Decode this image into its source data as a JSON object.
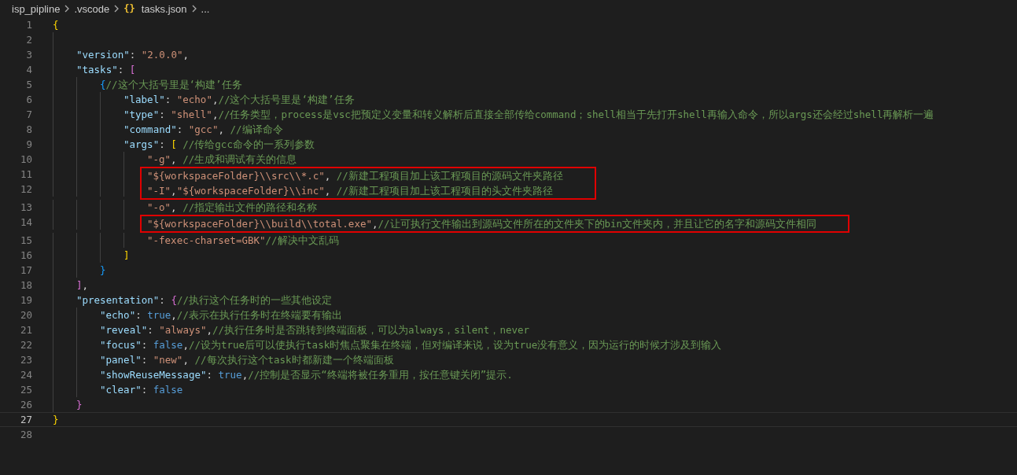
{
  "breadcrumb": [
    {
      "label": "isp_pipline",
      "kind": "folder"
    },
    {
      "label": ".vscode",
      "kind": "folder"
    },
    {
      "label": "tasks.json",
      "kind": "json",
      "icon": "{}"
    },
    {
      "label": "...",
      "kind": "more"
    }
  ],
  "lines": [
    {
      "number": "1",
      "boxed": false,
      "current": false,
      "tokens": [
        {
          "kind": "brace1",
          "text": "{"
        }
      ],
      "children": [
        {
          "number": "2",
          "boxed": false,
          "current": false
        },
        {
          "number": "3",
          "boxed": false,
          "current": false,
          "tokens": [
            {
              "kind": "key",
              "text": "\"version\""
            },
            {
              "kind": "punct",
              "text": ": "
            },
            {
              "kind": "string",
              "text": "\"2.0.0\""
            },
            {
              "kind": "punct",
              "text": ","
            }
          ]
        },
        {
          "number": "4",
          "boxed": false,
          "current": false,
          "tokens": [
            {
              "kind": "key",
              "text": "\"tasks\""
            },
            {
              "kind": "punct",
              "text": ": "
            },
            {
              "kind": "brace2",
              "text": "["
            }
          ],
          "children": [
            {
              "number": "5",
              "boxed": false,
              "current": false,
              "tokens": [
                {
                  "kind": "brace3",
                  "text": "{"
                },
                {
                  "kind": "comment",
                  "text": "//这个大括号里是‘构建’任务"
                }
              ],
              "children": [
                {
                  "number": "6",
                  "boxed": false,
                  "current": false,
                  "tokens": [
                    {
                      "kind": "key",
                      "text": "\"label\""
                    },
                    {
                      "kind": "punct",
                      "text": ": "
                    },
                    {
                      "kind": "string",
                      "text": "\"echo\""
                    },
                    {
                      "kind": "punct",
                      "text": ","
                    },
                    {
                      "kind": "comment",
                      "text": "//这个大括号里是‘构建’任务"
                    }
                  ]
                },
                {
                  "number": "7",
                  "boxed": false,
                  "current": false,
                  "tokens": [
                    {
                      "kind": "key",
                      "text": "\"type\""
                    },
                    {
                      "kind": "punct",
                      "text": ": "
                    },
                    {
                      "kind": "string",
                      "text": "\"shell\""
                    },
                    {
                      "kind": "punct",
                      "text": ","
                    },
                    {
                      "kind": "comment",
                      "text": "//任务类型，process是vsc把预定义变量和转义解析后直接全部传给command；shell相当于先打开shell再输入命令，所以args还会经过shell再解析一遍"
                    }
                  ]
                },
                {
                  "number": "8",
                  "boxed": false,
                  "current": false,
                  "tokens": [
                    {
                      "kind": "key",
                      "text": "\"command\""
                    },
                    {
                      "kind": "punct",
                      "text": ": "
                    },
                    {
                      "kind": "string",
                      "text": "\"gcc\""
                    },
                    {
                      "kind": "punct",
                      "text": ", "
                    },
                    {
                      "kind": "comment",
                      "text": "//编译命令"
                    }
                  ]
                },
                {
                  "number": "9",
                  "boxed": false,
                  "current": false,
                  "tokens": [
                    {
                      "kind": "key",
                      "text": "\"args\""
                    },
                    {
                      "kind": "punct",
                      "text": ": "
                    },
                    {
                      "kind": "brace1",
                      "text": "["
                    },
                    {
                      "kind": "comment",
                      "text": " //传给gcc命令的一系列参数"
                    }
                  ],
                  "children": [
                    {
                      "number": "10",
                      "boxed": false,
                      "current": false,
                      "tokens": [
                        {
                          "kind": "string",
                          "text": "\"-g\""
                        },
                        {
                          "kind": "punct",
                          "text": ", "
                        },
                        {
                          "kind": "comment",
                          "text": "//生成和调试有关的信息"
                        }
                      ]
                    },
                    {
                      "number": "11",
                      "boxed": true,
                      "current": false,
                      "tokens": [
                        {
                          "kind": "string",
                          "text": "\"${workspaceFolder}\\\\src\\\\*.c\""
                        },
                        {
                          "kind": "punct",
                          "text": ", "
                        },
                        {
                          "kind": "comment",
                          "text": "//新建工程项目加上该工程项目的源码文件夹路径"
                        }
                      ]
                    },
                    {
                      "number": "12",
                      "boxed": true,
                      "current": false,
                      "tokens": [
                        {
                          "kind": "string",
                          "text": "\"-I\""
                        },
                        {
                          "kind": "punct",
                          "text": ","
                        },
                        {
                          "kind": "string",
                          "text": "\"${workspaceFolder}\\\\inc\""
                        },
                        {
                          "kind": "punct",
                          "text": ", "
                        },
                        {
                          "kind": "comment",
                          "text": "//新建工程项目加上该工程项目的头文件夹路径"
                        }
                      ]
                    },
                    {
                      "number": "13",
                      "boxed": false,
                      "current": false,
                      "tokens": [
                        {
                          "kind": "string",
                          "text": "\"-o\""
                        },
                        {
                          "kind": "punct",
                          "text": ", "
                        },
                        {
                          "kind": "comment",
                          "text": "//指定输出文件的路径和名称"
                        }
                      ]
                    },
                    {
                      "number": "14",
                      "boxed": true,
                      "current": false,
                      "tokens": [
                        {
                          "kind": "string",
                          "text": "\"${workspaceFolder}\\\\build\\\\total.exe\""
                        },
                        {
                          "kind": "punct",
                          "text": ","
                        },
                        {
                          "kind": "comment",
                          "text": "//让可执行文件输出到源码文件所在的文件夹下的bin文件夹内，并且让它的名字和源码文件相同"
                        }
                      ]
                    },
                    {
                      "number": "15",
                      "boxed": false,
                      "current": false,
                      "tokens": [
                        {
                          "kind": "string",
                          "text": "\"-fexec-charset=GBK\""
                        },
                        {
                          "kind": "comment",
                          "text": "//解决中文乱码"
                        }
                      ]
                    }
                  ]
                },
                {
                  "number": "16",
                  "boxed": false,
                  "current": false,
                  "tokens": [
                    {
                      "kind": "brace1",
                      "text": "]"
                    }
                  ]
                }
              ]
            },
            {
              "number": "17",
              "boxed": false,
              "current": false,
              "tokens": [
                {
                  "kind": "brace3",
                  "text": "}"
                }
              ]
            }
          ]
        },
        {
          "number": "18",
          "boxed": false,
          "current": false,
          "tokens": [
            {
              "kind": "brace2",
              "text": "]"
            },
            {
              "kind": "punct",
              "text": ","
            }
          ]
        },
        {
          "number": "19",
          "boxed": false,
          "current": false,
          "tokens": [
            {
              "kind": "key",
              "text": "\"presentation\""
            },
            {
              "kind": "punct",
              "text": ": "
            },
            {
              "kind": "brace2",
              "text": "{"
            },
            {
              "kind": "comment",
              "text": "//执行这个任务时的一些其他设定"
            }
          ],
          "children": [
            {
              "number": "20",
              "boxed": false,
              "current": false,
              "tokens": [
                {
                  "kind": "key",
                  "text": "\"echo\""
                },
                {
                  "kind": "punct",
                  "text": ": "
                },
                {
                  "kind": "keyword",
                  "text": "true"
                },
                {
                  "kind": "punct",
                  "text": ","
                },
                {
                  "kind": "comment",
                  "text": "//表示在执行任务时在终端要有输出"
                }
              ]
            },
            {
              "number": "21",
              "boxed": false,
              "current": false,
              "tokens": [
                {
                  "kind": "key",
                  "text": "\"reveal\""
                },
                {
                  "kind": "punct",
                  "text": ": "
                },
                {
                  "kind": "string",
                  "text": "\"always\""
                },
                {
                  "kind": "punct",
                  "text": ","
                },
                {
                  "kind": "comment",
                  "text": "//执行任务时是否跳转到终端面板，可以为always，silent，never"
                }
              ]
            },
            {
              "number": "22",
              "boxed": false,
              "current": false,
              "tokens": [
                {
                  "kind": "key",
                  "text": "\"focus\""
                },
                {
                  "kind": "punct",
                  "text": ": "
                },
                {
                  "kind": "keyword",
                  "text": "false"
                },
                {
                  "kind": "punct",
                  "text": ","
                },
                {
                  "kind": "comment",
                  "text": "//设为true后可以使执行task时焦点聚集在终端，但对编译来说，设为true没有意义，因为运行的时候才涉及到输入"
                }
              ]
            },
            {
              "number": "23",
              "boxed": false,
              "current": false,
              "tokens": [
                {
                  "kind": "key",
                  "text": "\"panel\""
                },
                {
                  "kind": "punct",
                  "text": ": "
                },
                {
                  "kind": "string",
                  "text": "\"new\""
                },
                {
                  "kind": "punct",
                  "text": ", "
                },
                {
                  "kind": "comment",
                  "text": "//每次执行这个task时都新建一个终端面板"
                }
              ]
            },
            {
              "number": "24",
              "boxed": false,
              "current": false,
              "tokens": [
                {
                  "kind": "key",
                  "text": "\"showReuseMessage\""
                },
                {
                  "kind": "punct",
                  "text": ": "
                },
                {
                  "kind": "keyword",
                  "text": "true"
                },
                {
                  "kind": "punct",
                  "text": ","
                },
                {
                  "kind": "comment",
                  "text": "//控制是否显示“终端将被任务重用，按任意键关闭”提示."
                }
              ]
            },
            {
              "number": "25",
              "boxed": false,
              "current": false,
              "tokens": [
                {
                  "kind": "key",
                  "text": "\"clear\""
                },
                {
                  "kind": "punct",
                  "text": ": "
                },
                {
                  "kind": "keyword",
                  "text": "false"
                }
              ]
            }
          ]
        },
        {
          "number": "26",
          "boxed": false,
          "current": false,
          "tokens": [
            {
              "kind": "brace2",
              "text": "}"
            }
          ]
        }
      ]
    },
    {
      "number": "27",
      "boxed": false,
      "current": true,
      "tokens": [
        {
          "kind": "brace1",
          "text": "}"
        }
      ]
    },
    {
      "number": "28",
      "boxed": false,
      "current": false
    }
  ]
}
